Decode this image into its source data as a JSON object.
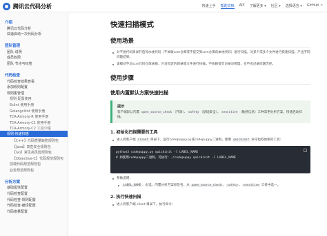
{
  "header": {
    "brand": "腾讯云代码分析",
    "nav": [
      "快速上手",
      "帮助文档",
      "API",
      "了解更多 ▾",
      "社区 ▾",
      "选择语言 ▾",
      "GitHub ↗"
    ],
    "active_nav_index": 1
  },
  "sidebar": {
    "groups": [
      {
        "title": "介绍",
        "items": [
          "腾讯云代码分析",
          "快速启动一次代码分析"
        ]
      },
      {
        "title": "团队管理",
        "items": [
          "团队·说明",
          "成员权限",
          "团队·节点与标签"
        ]
      },
      {
        "title": "代码检查",
        "items": [
          "代码检查结果查看",
          "添加规则配置",
          "规则集管理",
          "规则·配置使用",
          "Eslint 使用手册",
          "Golangcilint 使用手册",
          "TCA-Armory-R 使用手册",
          "TCA-Armory-C1 使用手册",
          "TCA-Armory-C2 工具介绍",
          "规则·快速扫描",
          "【C++】代码质量缺陷规则包",
          "【Java】高危安全规则包",
          "【Go】常见高风险规则包",
          "【Objective-C】代码规范规则包",
          "前端代码规范规则包",
          "业务规范规则包"
        ]
      },
      {
        "title": "分析方案",
        "items": [
          "基础属性配置",
          "代码检查配置",
          "代码检查-规则配置",
          "代码检查-编译配置",
          "代码度量配置"
        ]
      }
    ],
    "active_item": "规则·快速扫描"
  },
  "main": {
    "title": "快速扫描模式",
    "section1": {
      "heading": "使用场景",
      "bullets": [
        "对不想代码目录开启流水线代码（不关联scm仓库或不提交到scm仓库的本地代码）进行扫描，对某个或多个文件进行快速扫描，产出不同问题结果。",
        "该模式不与scm代码仓库关联，只对指定的目录或文件进行扫描，不依赖提交记录与管理，也不会记录问题历史。"
      ]
    },
    "section2": {
      "heading": "使用步骤",
      "sub_heading": "使用内置默认方案快速扫描",
      "tip": {
        "title": "提示",
        "body_parts": [
          "客户端默认内置 ",
          "open_source_check",
          "（开源）、",
          "safety",
          "（基础安全）、",
          "sensitive",
          "（敏感信息）三种常用分析方案，快速启动扫描。"
        ]
      },
      "step1": {
        "heading": "1. 初始化扫描需要的工具",
        "bullet_parts": [
          "进入到客户端 ",
          "client",
          " 目录下，运行codepuppy.py或codepuppy二进制，使用 ",
          "quickinit",
          " 命令拉取依赖的工具："
        ],
        "code_lines": [
          "python3 codepuppy.py quickinit -l LABEL_NAME",
          "",
          "# 如使用codepuppy二进制，可执行：./codepuppy quickinit -l LABEL_NAME"
        ],
        "params_label": "参数说明：",
        "param_parts": [
          "LABEL_NAME",
          "：必选，内置分析方案标签名，从 ",
          "open_source_check",
          "、",
          "safety",
          "、",
          "sensitive",
          " 三者中选一。"
        ]
      },
      "step2": {
        "heading": "2. 执行快速扫描",
        "bullet": "进入到客户端 client 目录下，执行命令："
      }
    }
  }
}
